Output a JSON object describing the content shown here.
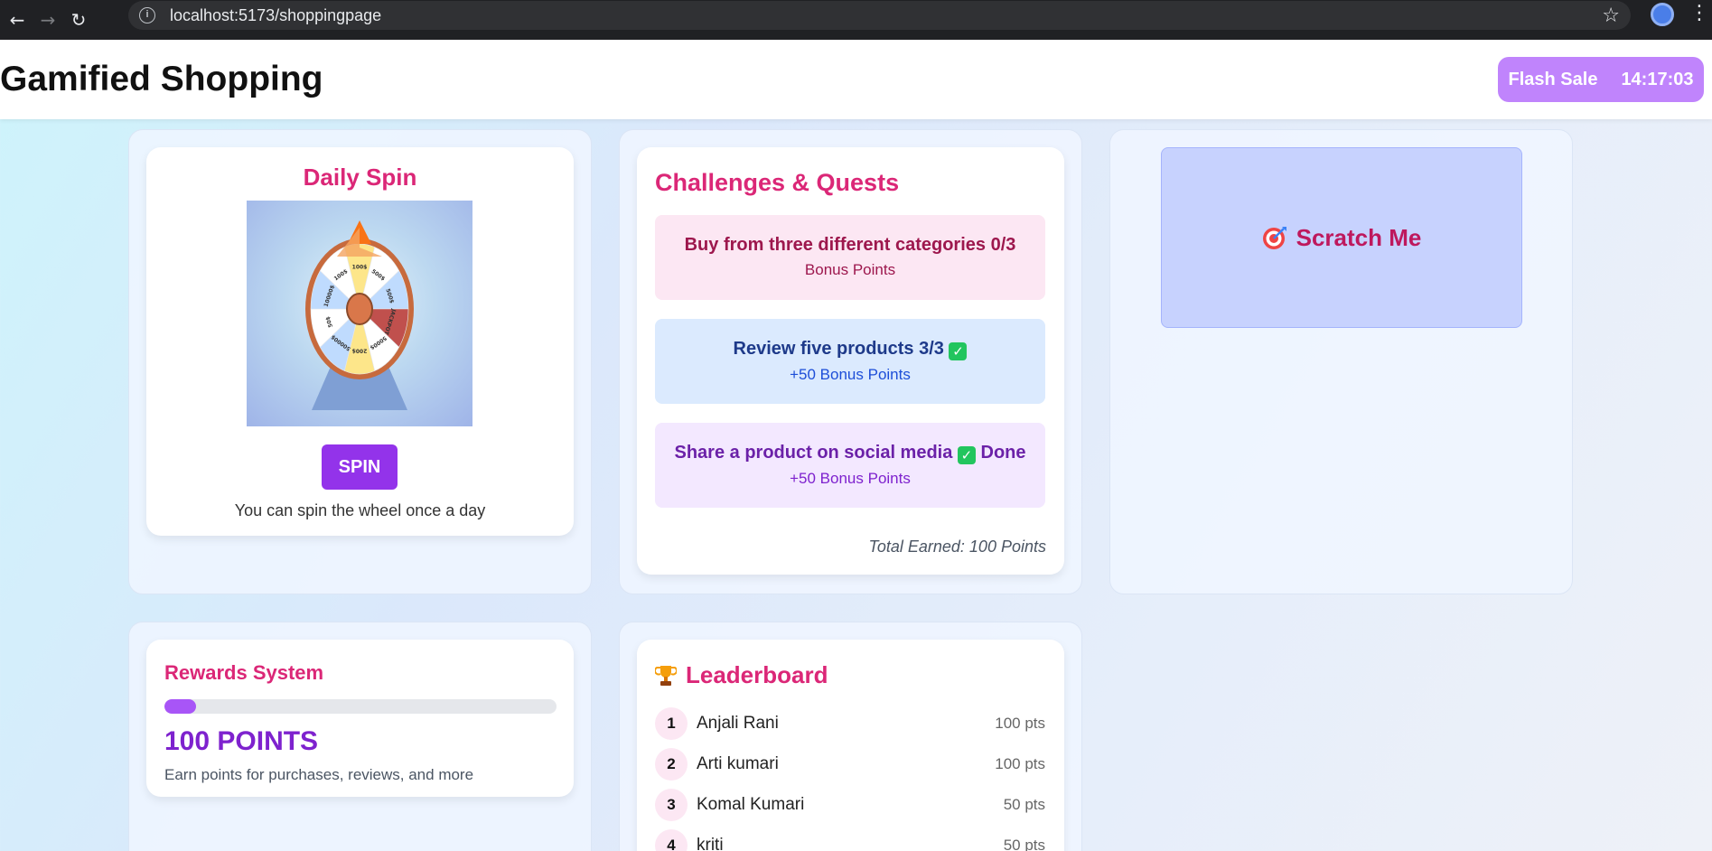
{
  "browser": {
    "url": "localhost:5173/shoppingpage"
  },
  "header": {
    "title": "Gamified Shopping",
    "flash_label": "Flash Sale",
    "flash_timer": "14:17:03"
  },
  "spin": {
    "title": "Daily Spin",
    "button": "SPIN",
    "note": "You can spin the wheel once a day",
    "wheel_labels": [
      "100$",
      "500$",
      "500$",
      "JACKPOT",
      "5000$",
      "200$",
      "50000$",
      "50$",
      "10000$",
      "100$"
    ]
  },
  "challenges": {
    "title": "Challenges & Quests",
    "quests": [
      {
        "label": "Buy from three different categories 0/3",
        "reward": "Bonus Points",
        "status": ""
      },
      {
        "label": "Review five products 3/3",
        "reward": "+50 Bonus Points",
        "status": ""
      },
      {
        "label": "Share a product on social media",
        "reward": "+50 Bonus Points",
        "status": "Done"
      }
    ],
    "total": "Total Earned: 100 Points"
  },
  "scratch": {
    "label": "Scratch Me",
    "icon": "target-icon"
  },
  "rewards": {
    "title": "Rewards System",
    "progress_fraction": 0.08,
    "points": "100 POINTS",
    "description": "Earn points for purchases, reviews, and more"
  },
  "leaderboard": {
    "title": "Leaderboard",
    "icon": "trophy-icon",
    "rows": [
      {
        "rank": "1",
        "name": "Anjali Rani",
        "points": "100 pts"
      },
      {
        "rank": "2",
        "name": "Arti kumari",
        "points": "100 pts"
      },
      {
        "rank": "3",
        "name": "Komal Kumari",
        "points": "50 pts"
      },
      {
        "rank": "4",
        "name": "kriti",
        "points": "50 pts"
      }
    ]
  }
}
